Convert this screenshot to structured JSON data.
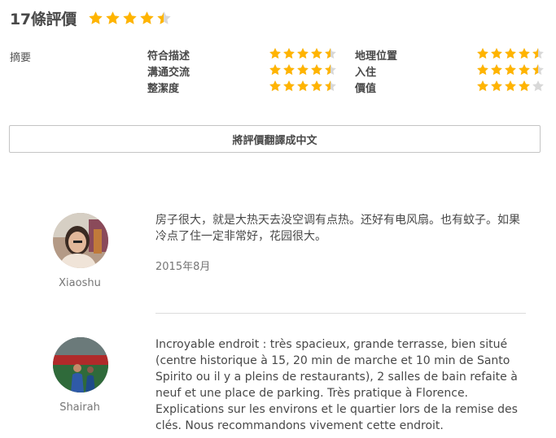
{
  "header": {
    "title": "17條評價",
    "overall_rating": 4.5
  },
  "summary": {
    "label": "摘要",
    "categories": [
      {
        "label": "符合描述",
        "rating": 4.5
      },
      {
        "label": "地理位置",
        "rating": 4.5
      },
      {
        "label": "溝通交流",
        "rating": 4.5
      },
      {
        "label": "入住",
        "rating": 4.5
      },
      {
        "label": "整潔度",
        "rating": 4.5
      },
      {
        "label": "價值",
        "rating": 4
      }
    ]
  },
  "translate_button": {
    "label": "將評價翻譯成中文"
  },
  "reviews": [
    {
      "name": "Xiaoshu",
      "text": "房子很大，就是大热天去没空调有点热。还好有电风扇。也有蚊子。如果冷点了住一定非常好，花园很大。",
      "date": "2015年8月"
    },
    {
      "name": "Shairah",
      "text": "Incroyable endroit : très spacieux, grande terrasse, bien situé (centre historique à 15, 20 min de marche et 10 min de Santo Spirito ou il y a pleins de restaurants), 2 salles de bain refaite à neuf et une place de parking. Très pratique à Florence. Explications sur les environs et le quartier lors de la remise des clés. Nous recommandons vivement cette endroit."
    }
  ],
  "colors": {
    "star_filled": "#ffb400",
    "star_empty": "#d8d8d8",
    "text": "#484848",
    "muted": "#767676"
  }
}
